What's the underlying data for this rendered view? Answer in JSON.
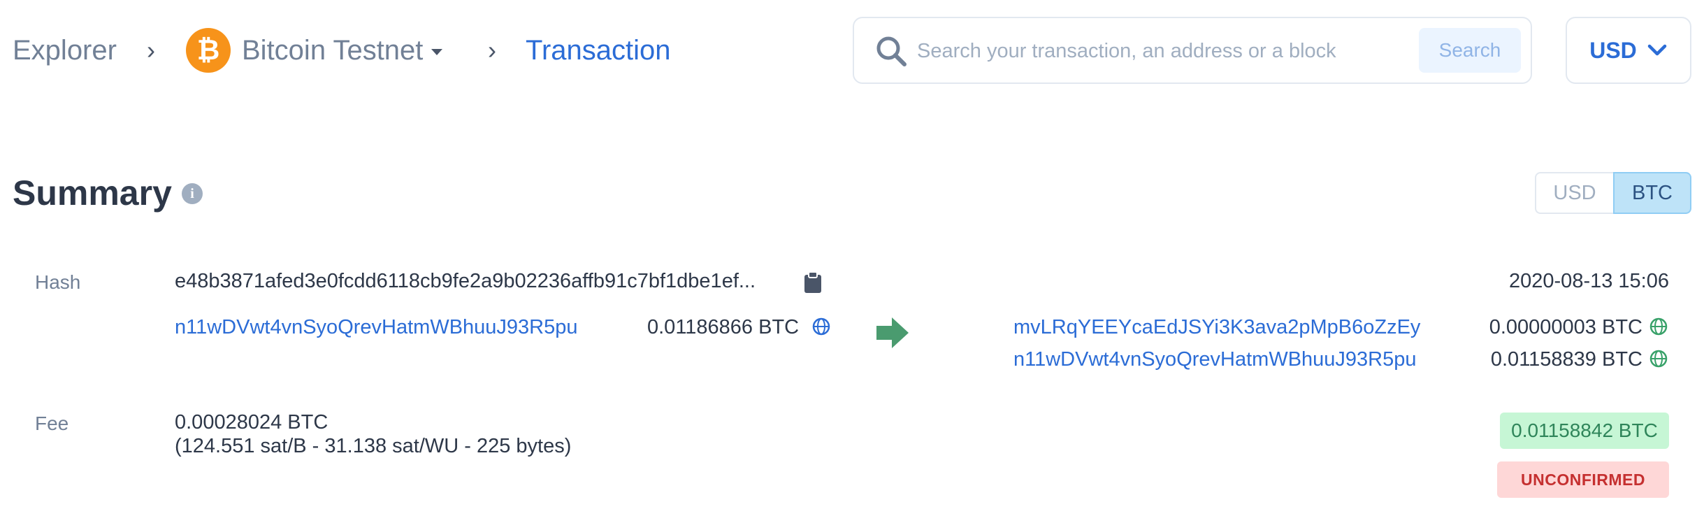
{
  "breadcrumb": {
    "explorer": "Explorer",
    "separator": "›",
    "network": "Bitcoin Testnet",
    "network_icon": "bitcoin-icon",
    "network_symbol": "₿",
    "current": "Transaction"
  },
  "search": {
    "placeholder": "Search your transaction, an address or a block",
    "button_label": "Search"
  },
  "currency_select": {
    "value": "USD",
    "icon": "chevron-down-icon"
  },
  "summary": {
    "title": "Summary",
    "info_icon": "info-icon",
    "info_symbol": "i",
    "toggle": {
      "usd": "USD",
      "btc": "BTC",
      "active": "BTC"
    }
  },
  "transaction": {
    "hash_label": "Hash",
    "hash": "e48b3871afed3e0fcdd6118cb9fe2a9b02236affb91c7bf1dbe1ef...",
    "timestamp": "2020-08-13 15:06",
    "inputs": [
      {
        "address": "n11wDVwt4vnSyoQrevHatmWBhuuJ93R5pu",
        "amount": "0.01186866 BTC"
      }
    ],
    "outputs": [
      {
        "address": "mvLRqYEEYcaEdJSYi3K3ava2pMpB6oZzEy",
        "amount": "0.00000003 BTC"
      },
      {
        "address": "n11wDVwt4vnSyoQrevHatmWBhuuJ93R5pu",
        "amount": "0.01158839 BTC"
      }
    ],
    "fee_label": "Fee",
    "fee": "0.00028024 BTC",
    "fee_details": "(124.551 sat/B - 31.138 sat/WU - 225 bytes)",
    "total_output": "0.01158842 BTC",
    "status": "UNCONFIRMED"
  },
  "colors": {
    "link": "#2b6cd6",
    "bitcoin": "#f7931a",
    "arrow": "#4a9b6f",
    "confirmed_bg": "#c6f6d5",
    "unconfirmed_bg": "#fed7d7"
  }
}
